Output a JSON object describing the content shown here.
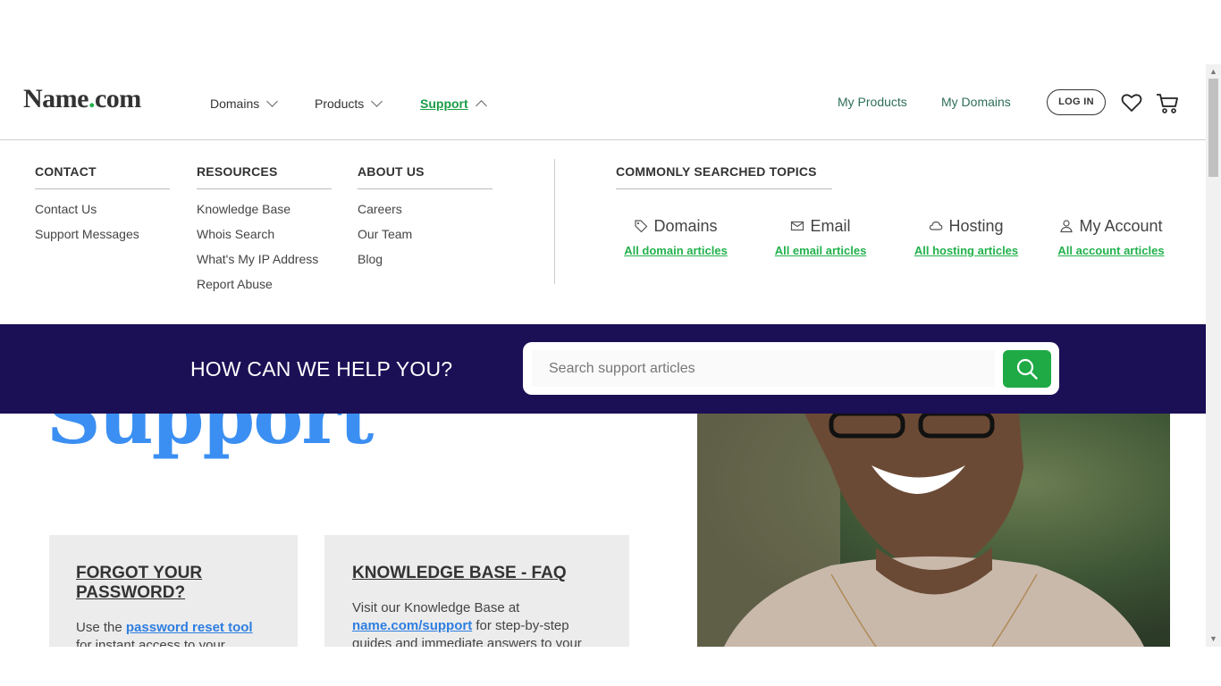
{
  "header": {
    "logo_name": "Name",
    "logo_dot": ".",
    "logo_tld": "com",
    "nav": [
      {
        "label": "Domains"
      },
      {
        "label": "Products"
      },
      {
        "label": "Support"
      }
    ],
    "my_products": "My Products",
    "my_domains": "My Domains",
    "login": "LOG IN",
    "icons": {
      "favorites": "heart-icon",
      "cart": "cart-icon"
    }
  },
  "menu": {
    "columns": [
      {
        "title": "CONTACT",
        "items": [
          "Contact Us",
          "Support Messages"
        ]
      },
      {
        "title": "RESOURCES",
        "items": [
          "Knowledge Base",
          "Whois Search",
          "What's My IP Address",
          "Report Abuse"
        ]
      },
      {
        "title": "ABOUT US",
        "items": [
          "Careers",
          "Our Team",
          "Blog"
        ]
      }
    ],
    "topics_title": "COMMONLY SEARCHED TOPICS",
    "topics": [
      {
        "label": "Domains",
        "link": "All domain articles",
        "icon": "tag-icon"
      },
      {
        "label": "Email",
        "link": "All email articles",
        "icon": "envelope-icon"
      },
      {
        "label": "Hosting",
        "link": "All hosting articles",
        "icon": "cloud-icon"
      },
      {
        "label": "My Account",
        "link": "All account articles",
        "icon": "user-icon"
      }
    ]
  },
  "helpbar": {
    "title": "HOW CAN WE HELP YOU?",
    "search_placeholder": "Search support articles"
  },
  "hero": {
    "heading": "Support"
  },
  "cards": [
    {
      "title": "FORGOT YOUR PASSWORD?",
      "text_before": "Use the ",
      "link": "password reset tool",
      "text_after": " for instant access to your"
    },
    {
      "title": "KNOWLEDGE BASE - FAQ",
      "text_before": "Visit our Knowledge Base at ",
      "link": "name.com/support",
      "text_after": " for step-by-step guides and immediate answers to your"
    }
  ],
  "colors": {
    "brand_green": "#22b14c",
    "helpbar_bg": "#1b0f55",
    "hero_blue": "#3b8ff2"
  }
}
